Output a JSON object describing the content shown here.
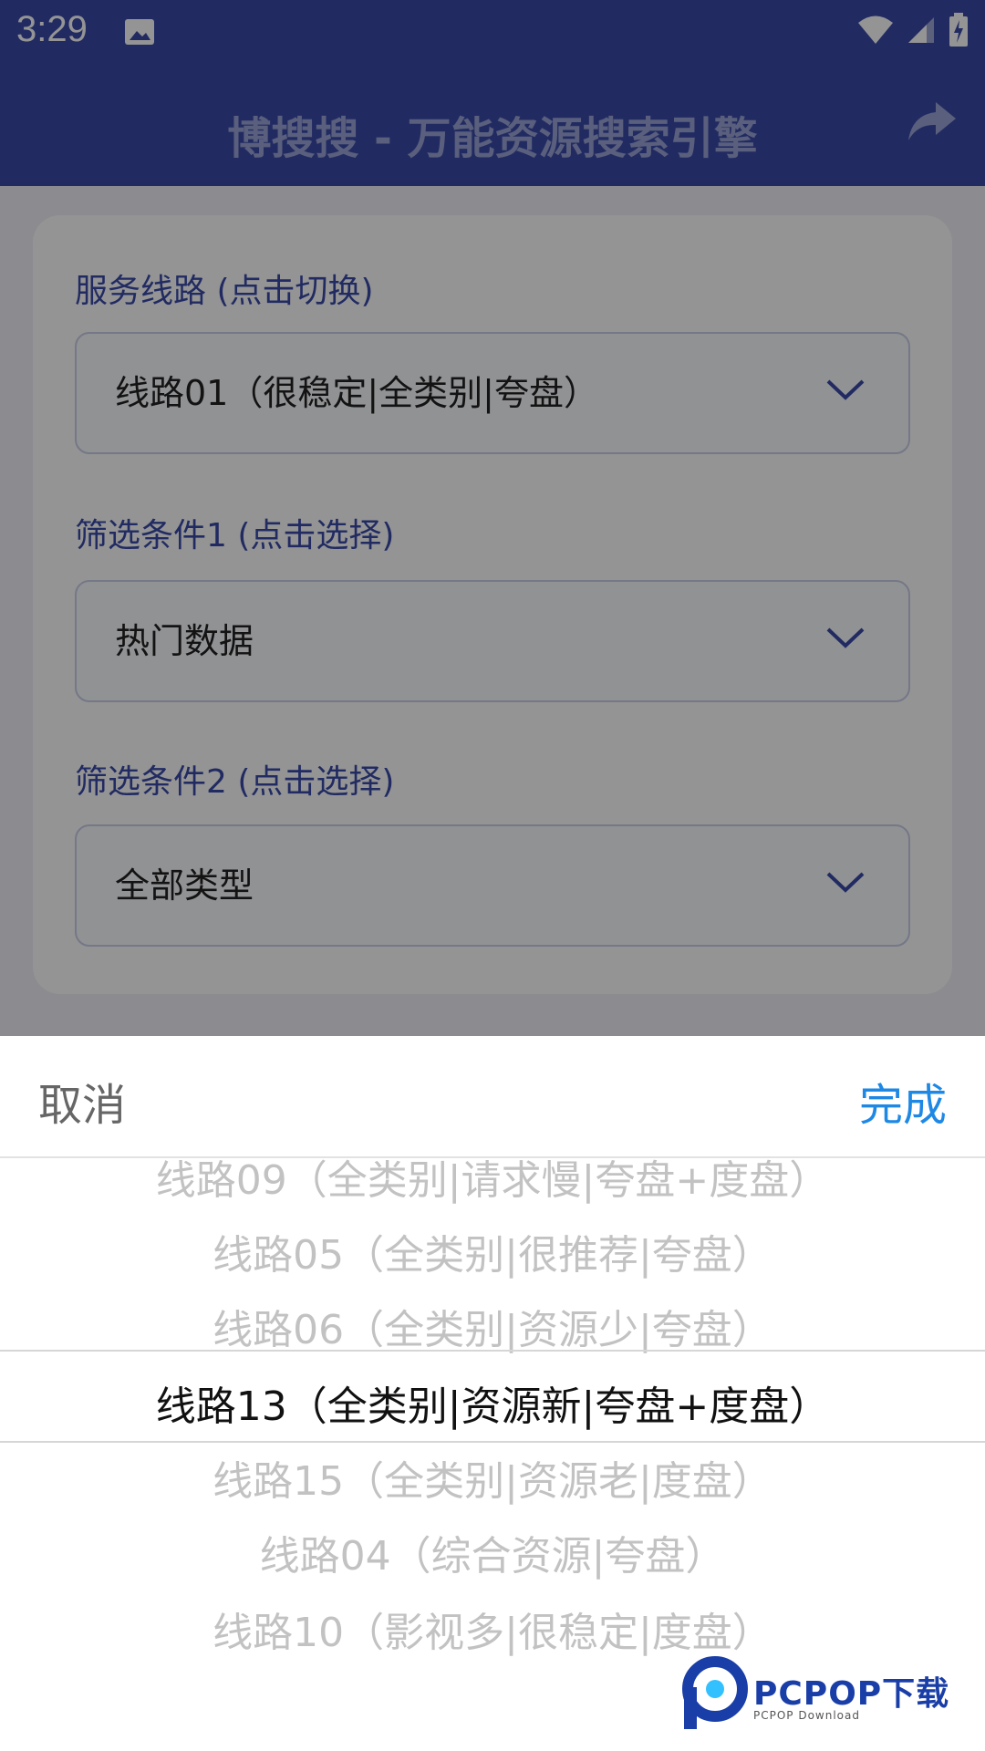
{
  "status_bar": {
    "time": "3:29"
  },
  "app_bar": {
    "title": "博搜搜 - 万能资源搜索引擎"
  },
  "form": {
    "route_label": "服务线路 (点击切换)",
    "route_value": "线路01（很稳定|全类别|夸盘）",
    "filter1_label": "筛选条件1 (点击选择)",
    "filter1_value": "热门数据",
    "filter2_label": "筛选条件2 (点击选择)",
    "filter2_value": "全部类型"
  },
  "picker": {
    "cancel_label": "取消",
    "done_label": "完成",
    "options": [
      "线路09（全类别|请求慢|夸盘+度盘）",
      "线路05（全类别|很推荐|夸盘）",
      "线路06（全类别|资源少|夸盘）",
      "线路13（全类别|资源新|夸盘+度盘）",
      "线路15（全类别|资源老|度盘）",
      "线路04（综合资源|夸盘）",
      "线路10（影视多|很稳定|度盘）"
    ],
    "selected_index": 3
  },
  "watermark": {
    "brand": "PCPOP下载",
    "sub": "PCPOP Download"
  },
  "colors": {
    "primary": "#3a4baa",
    "accent": "#1e88e5"
  }
}
